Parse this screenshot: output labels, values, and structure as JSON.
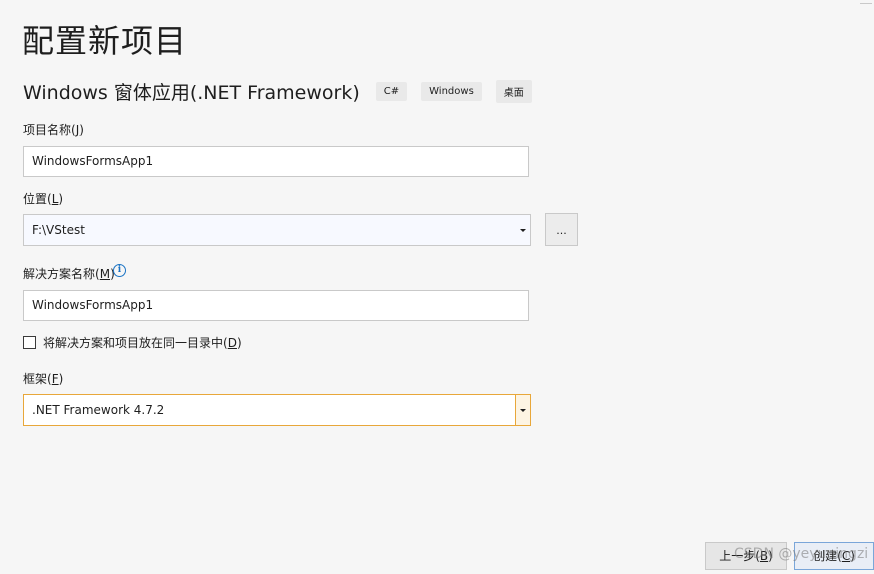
{
  "header": {
    "title": "配置新项目"
  },
  "template": {
    "name": "Windows 窗体应用(.NET Framework)",
    "tags": [
      "C#",
      "Windows",
      "桌面"
    ]
  },
  "project_name": {
    "label": "项目名称",
    "hotkey": "J",
    "value": "WindowsFormsApp1"
  },
  "location": {
    "label": "位置",
    "hotkey": "L",
    "value": "F:\\VStest",
    "browse_label": "..."
  },
  "solution_name": {
    "label": "解决方案名称",
    "hotkey": "M",
    "value": "WindowsFormsApp1",
    "info_icon": "i"
  },
  "same_directory": {
    "label": "将解决方案和项目放在同一目录中",
    "hotkey": "D",
    "checked": false
  },
  "framework": {
    "label": "框架",
    "hotkey": "F",
    "value": ".NET Framework 4.7.2"
  },
  "footer": {
    "back_label": "上一步",
    "back_hotkey": "B",
    "create_label": "创建",
    "create_hotkey": "C"
  },
  "watermark": "CSDN @yeyuningzi",
  "colors": {
    "focus_border": "#e8a73a",
    "info_blue": "#1a73c4",
    "background": "#f6f6f6"
  }
}
